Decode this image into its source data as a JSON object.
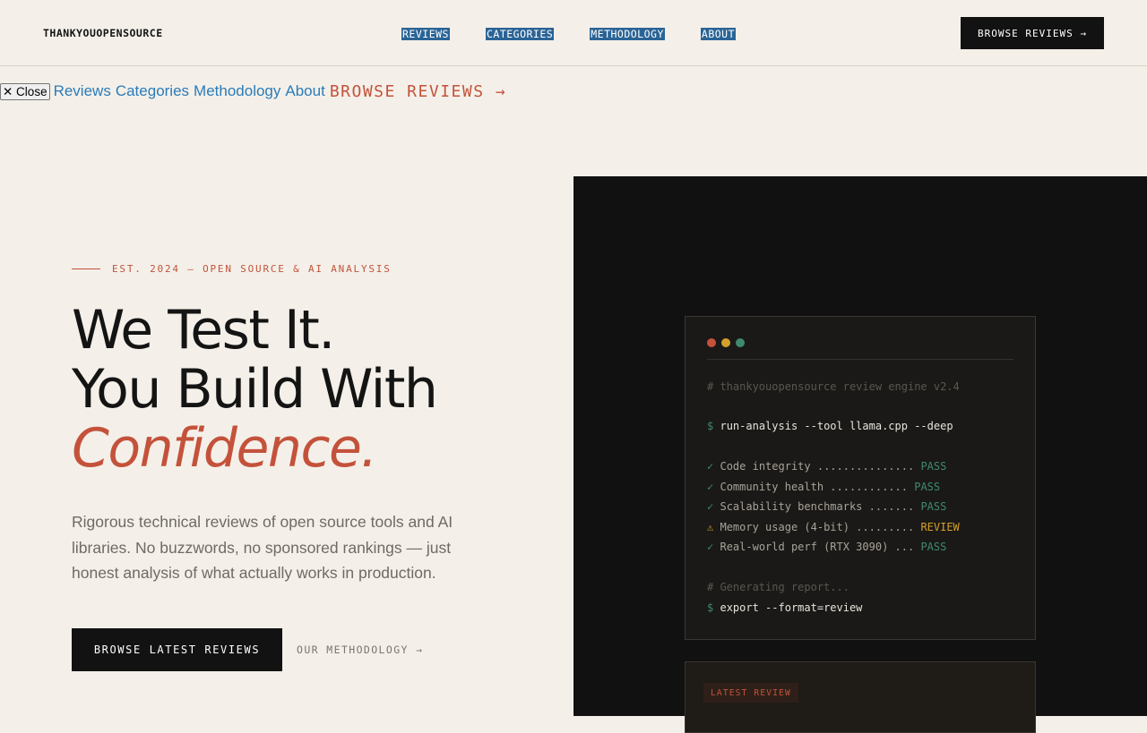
{
  "header": {
    "logo": "THANKYOUOPENSOURCE",
    "nav": [
      "REVIEWS",
      "CATEGORIES",
      "METHODOLOGY",
      "ABOUT"
    ],
    "cta": "BROWSE REVIEWS →"
  },
  "mobile_menu": {
    "close": "✕ Close",
    "links": [
      "Reviews",
      "Categories",
      "Methodology",
      "About"
    ],
    "cta": "BROWSE REVIEWS →"
  },
  "hero": {
    "eyebrow": "EST. 2024 — OPEN SOURCE & AI ANALYSIS",
    "headline_1": "We Test It.",
    "headline_2": "You Build With",
    "headline_accent": "Confidence.",
    "subtext": "Rigorous technical reviews of open source tools and AI libraries. No buzzwords, no sponsored rankings — just honest analysis of what actually works in production.",
    "primary_button": "BROWSE LATEST REVIEWS",
    "secondary_link": "OUR METHODOLOGY →"
  },
  "terminal": {
    "dot_colors": [
      "#c4523b",
      "#d4a02a",
      "#3f8a6e"
    ],
    "comment_1": "# thankyouopensource review engine v2.4",
    "prompt": "$",
    "command_1": "run-analysis --tool llama.cpp --deep",
    "checks": [
      {
        "mark": "✓",
        "label": "Code integrity ............... ",
        "status": "PASS"
      },
      {
        "mark": "✓",
        "label": "Community health ............ ",
        "status": "PASS"
      },
      {
        "mark": "✓",
        "label": "Scalability benchmarks ....... ",
        "status": "PASS"
      },
      {
        "mark": "⚠",
        "label": "Memory usage (4-bit) ......... ",
        "status": "REVIEW"
      },
      {
        "mark": "✓",
        "label": "Real-world perf (RTX 3090) ... ",
        "status": "PASS"
      }
    ],
    "comment_2": "# Generating report...",
    "command_2": "export --format=review"
  },
  "review_card": {
    "tag": "LATEST REVIEW"
  }
}
